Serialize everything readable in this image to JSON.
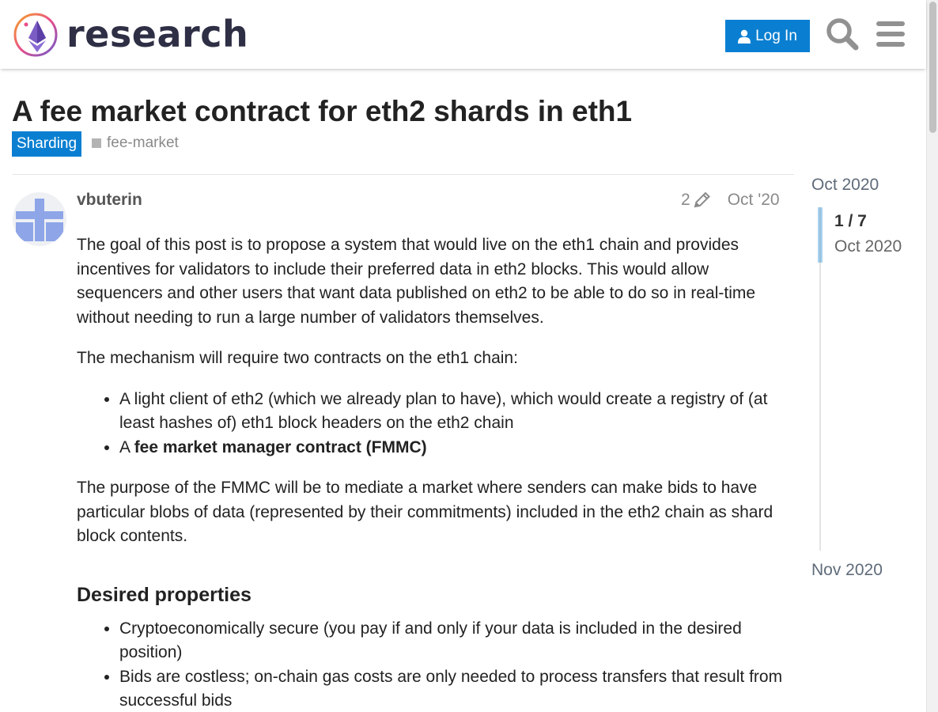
{
  "header": {
    "logo_text": "research",
    "login_label": "Log In"
  },
  "topic": {
    "title": "A fee market contract for eth2 shards in eth1",
    "category": "Sharding",
    "tag": "fee-market"
  },
  "post": {
    "username": "vbuterin",
    "edit_count": "2",
    "date": "Oct '20",
    "paragraph_1": "The goal of this post is to propose a system that would live on the eth1 chain and provides incentives for validators to include their preferred data in eth2 blocks. This would allow sequencers and other users that want data published on eth2 to be able to do so in real-time without needing to run a large number of validators themselves.",
    "paragraph_2": "The mechanism will require two contracts on the eth1 chain:",
    "list_1": [
      "A light client of eth2 (which we already plan to have), which would create a registry of (at least hashes of) eth1 block headers on the eth2 chain"
    ],
    "list_1_item_2_prefix": "A ",
    "list_1_item_2_bold": "fee market manager contract (FMMC)",
    "paragraph_3": "The purpose of the FMMC will be to mediate a market where senders can make bids to have particular blobs of data (represented by their commitments) included in the eth2 chain as shard block contents.",
    "heading": "Desired properties",
    "list_2": [
      "Cryptoeconomically secure (you pay if and only if your data is included in the desired position)",
      "Bids are costless; on-chain gas costs are only needed to process transfers that result from successful bids"
    ]
  },
  "timeline": {
    "start": "Oct 2020",
    "position": "1 / 7",
    "current_date": "Oct 2020",
    "end": "Nov 2020"
  },
  "colors": {
    "accent": "#0a7fd1",
    "avatar": "#8ea6e8"
  }
}
